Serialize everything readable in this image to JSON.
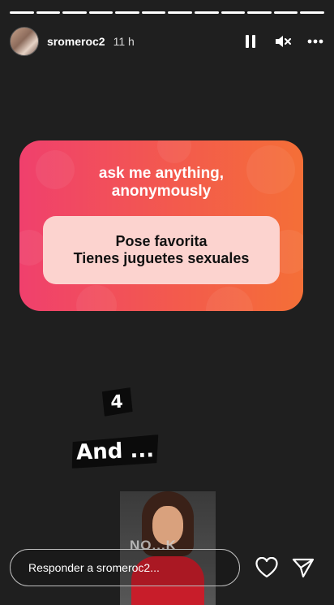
{
  "progress": {
    "segments": 12
  },
  "header": {
    "username": "sromeroc2",
    "time": "11 h",
    "icons": [
      "pause-icon",
      "muted-icon",
      "more-icon"
    ]
  },
  "card": {
    "title_line1": "ask me anything,",
    "title_line2": "anonymously",
    "answer_line1": "Pose favorita",
    "answer_line2": "Tienes juguetes sexuales",
    "colors": {
      "gradient_start": "#f0406d",
      "gradient_end": "#f46f37",
      "answer_bg": "#fcd3cf"
    }
  },
  "stickers": {
    "number": "4",
    "text": "And ..."
  },
  "gif": {
    "caption": "NO...K"
  },
  "reply": {
    "placeholder": "Responder a sromeroc2...",
    "icons": [
      "heart-icon",
      "send-icon"
    ]
  }
}
